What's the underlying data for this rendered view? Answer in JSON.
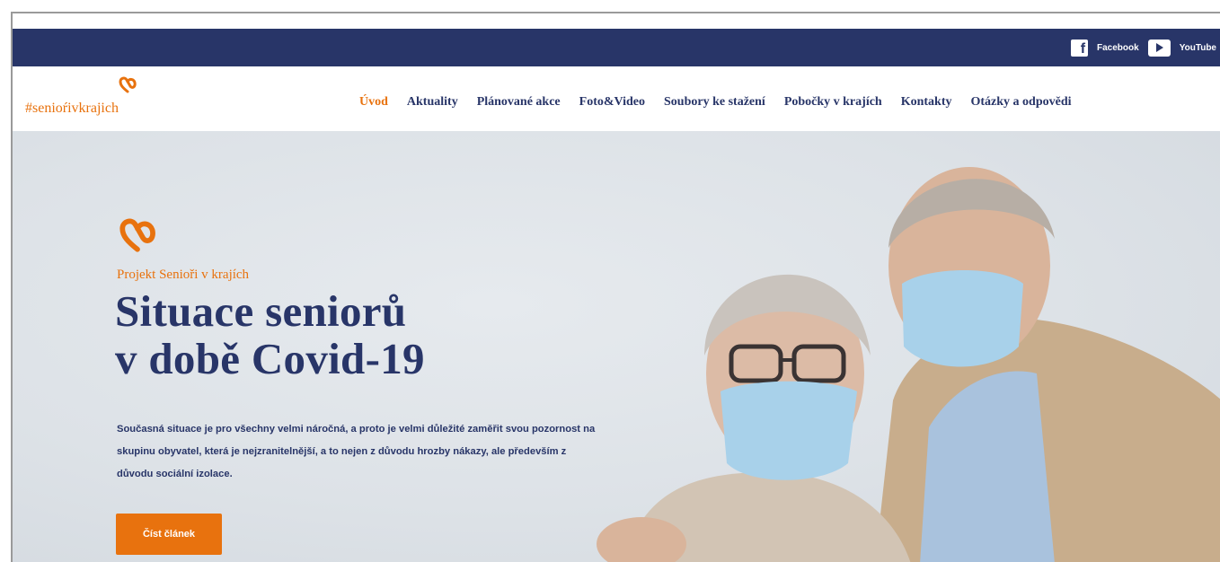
{
  "topbar": {
    "social": [
      {
        "icon": "facebook-icon",
        "label": "Facebook"
      },
      {
        "icon": "youtube-icon",
        "label": "YouTube"
      }
    ]
  },
  "logo": {
    "text": "#senioŕivkrajich",
    "icon": "heart-logo-icon"
  },
  "nav": {
    "items": [
      {
        "label": "Úvod",
        "active": true
      },
      {
        "label": "Aktuality"
      },
      {
        "label": "Plánované akce"
      },
      {
        "label": "Foto&Video"
      },
      {
        "label": "Soubory ke stažení"
      },
      {
        "label": "Pobočky v krajích"
      },
      {
        "label": "Kontakty"
      },
      {
        "label": "Otázky a odpovědi"
      }
    ]
  },
  "hero": {
    "project_label": "Projekt Senioři v krajích",
    "title_line1": "Situace seniorů",
    "title_line2": "v době Covid-19",
    "description": "Současná situace je pro všechny velmi náročná, a proto je velmi důležité zaměřit svou pozornost na skupinu obyvatel, která je nejzranitelnější, a to nejen z důvodu hrozby nákazy, ale především z důvodu sociální izolace.",
    "cta_label": "Číst článek"
  },
  "colors": {
    "accent": "#e8720e",
    "brand": "#283568"
  }
}
